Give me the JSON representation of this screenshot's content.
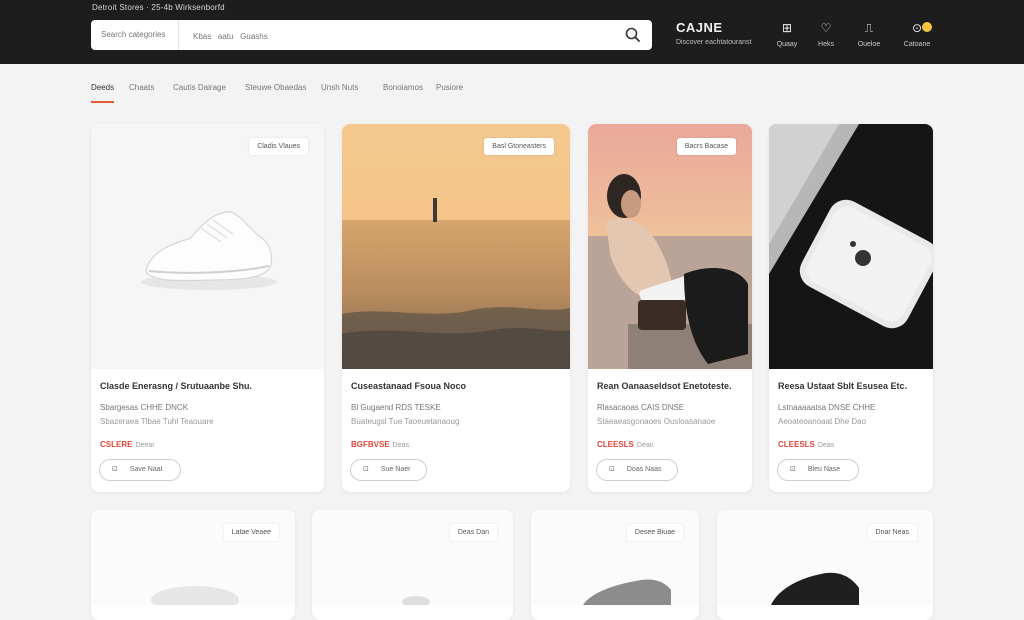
{
  "header": {
    "crumb": "Detroit Stores · 25-4b Wirksenborfd",
    "search_category": "Search categories",
    "search_placeholder": "Kbas   aatu   Guashs",
    "brand": "CAJNE",
    "brand_sub": "Discover eachtatouranst",
    "icons": [
      {
        "name": "store",
        "glyph": "⊞",
        "label": "Quaay"
      },
      {
        "name": "wishlist",
        "glyph": "♡",
        "label": "Heks"
      },
      {
        "name": "account",
        "glyph": "⎍",
        "label": "Oueloe"
      },
      {
        "name": "cart",
        "glyph": "⊙",
        "label": "Catoane"
      }
    ]
  },
  "tabs": [
    "Deeds",
    "Chaats",
    "Cautis Dairage",
    "Steuwe Obaedas",
    "Unsh Nuts",
    "Bonoiamos",
    "Pusiore"
  ],
  "products": [
    {
      "badge": "Cladis Vlaues",
      "title": "Clasde Enerasng / Srutuaanbe Shu.",
      "meta": "Sbargesas  CHHE DNCK",
      "meta2": "Sbazeraea  Tlbae  Tuhl  Teaouare",
      "price": "CSLERE",
      "old": "Deear",
      "button": "Save Naat"
    },
    {
      "badge": "Basl Gtoneasters",
      "title": "Cuseastanaad Fsoua Noco",
      "meta": "Bl Gugaend  RDS  TESKE",
      "meta2": "Buateugsl  Tue  Taoeuetanaoug",
      "price": "BGFBVSE",
      "old": "Deas",
      "button": "Sue Naer"
    },
    {
      "badge": "Bacrs Bacase",
      "title": "Rean Oanaaseldsot Enetoteste.",
      "meta": "Rlasacaoas  CAIS DNSE",
      "meta2": "Staeaeasgonaoes  Ousloasanaoe",
      "price": "CLEESLS",
      "old": "Dean",
      "button": "Doas Naas"
    },
    {
      "badge": "",
      "title": "Reesa Ustaat Sblt Esusea Etc.",
      "meta": "Lstnaaaaatsa  DNSE  CHHE",
      "meta2": "Aeoateoanoaat  Dhe  Dao",
      "price": "CLEESLS",
      "old": "Deas",
      "button": "Bleu Nase"
    }
  ],
  "row2_badges": [
    "Latae Veaee",
    "Deas Dan",
    "Desee Biuae",
    "Dnar Neas"
  ],
  "colors": {
    "accent": "#e05a3a",
    "price": "#e0463a",
    "header": "#1d1d1d",
    "cart_dot": "#f5c542"
  }
}
